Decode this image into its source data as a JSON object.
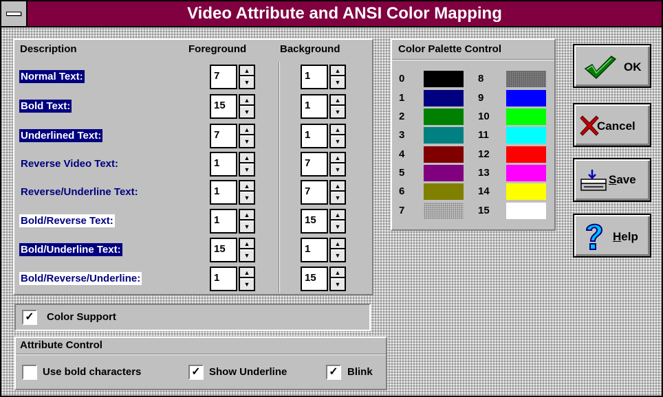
{
  "window": {
    "title": "Video Attribute and ANSI Color Mapping"
  },
  "mapping": {
    "headers": {
      "description": "Description",
      "foreground": "Foreground",
      "background": "Background"
    },
    "rows": [
      {
        "label": "Normal Text:",
        "fg": "7",
        "bg": "1"
      },
      {
        "label": "Bold Text:",
        "fg": "15",
        "bg": "1"
      },
      {
        "label": "Underlined Text:",
        "fg": "7",
        "bg": "1"
      },
      {
        "label": "Reverse Video Text:",
        "fg": "1",
        "bg": "7"
      },
      {
        "label": "Reverse/Underline Text:",
        "fg": "1",
        "bg": "7"
      },
      {
        "label": "Bold/Reverse Text:",
        "fg": "1",
        "bg": "15"
      },
      {
        "label": "Bold/Underline Text:",
        "fg": "15",
        "bg": "1"
      },
      {
        "label": "Bold/Reverse/Underline:",
        "fg": "1",
        "bg": "15"
      }
    ]
  },
  "color_support": {
    "label": "Color Support",
    "checked": true
  },
  "attribute_control": {
    "title": "Attribute Control",
    "use_bold": {
      "label": "Use bold characters",
      "checked": false
    },
    "show_underline": {
      "label": "Show Underline",
      "checked": true
    },
    "blink": {
      "label": "Blink",
      "checked": true
    }
  },
  "palette": {
    "title": "Color Palette Control",
    "left": [
      {
        "num": "0",
        "color": "#000000"
      },
      {
        "num": "1",
        "color": "#000080"
      },
      {
        "num": "2",
        "color": "#008000"
      },
      {
        "num": "3",
        "color": "#008080"
      },
      {
        "num": "4",
        "color": "#800000"
      },
      {
        "num": "5",
        "color": "#800080"
      },
      {
        "num": "6",
        "color": "#808000"
      },
      {
        "num": "7",
        "color": "#c0c0c0"
      }
    ],
    "right": [
      {
        "num": "8",
        "color": "#808080"
      },
      {
        "num": "9",
        "color": "#0000ff"
      },
      {
        "num": "10",
        "color": "#00ff00"
      },
      {
        "num": "11",
        "color": "#00ffff"
      },
      {
        "num": "12",
        "color": "#ff0000"
      },
      {
        "num": "13",
        "color": "#ff00ff"
      },
      {
        "num": "14",
        "color": "#ffff00"
      },
      {
        "num": "15",
        "color": "#ffffff"
      }
    ]
  },
  "buttons": {
    "ok": "OK",
    "cancel": "Cancel",
    "save_prefix": "S",
    "save_rest": "ave",
    "help_prefix": "H",
    "help_rest": "elp"
  },
  "spinner_glyphs": {
    "up": "▲",
    "down": "▼",
    "check": "✓"
  }
}
